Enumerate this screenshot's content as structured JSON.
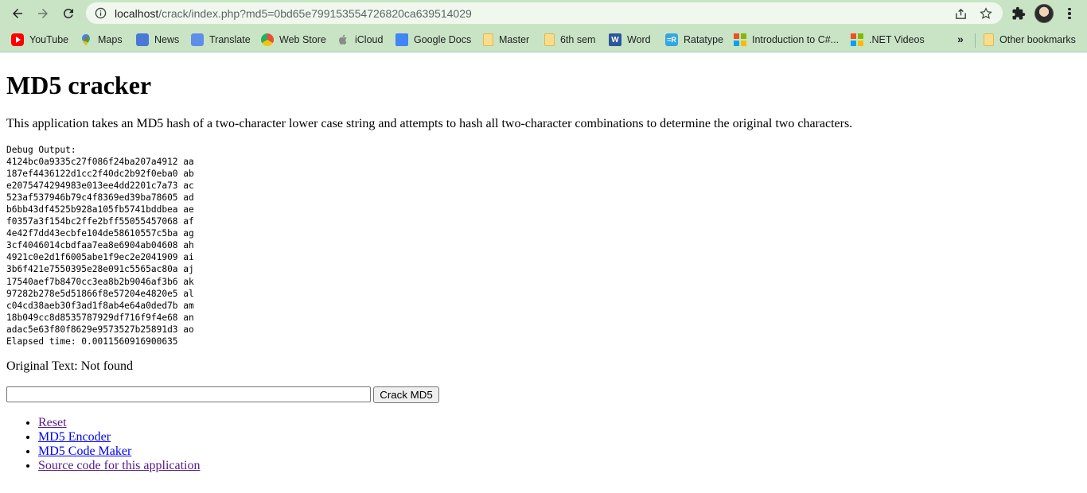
{
  "browser": {
    "url_host": "localhost",
    "url_path": "/crack/index.php?md5=0bd65e799153554726820ca639514029",
    "icons": {
      "back": "arrow-left-icon",
      "forward": "arrow-right-icon",
      "reload": "reload-icon",
      "info": "info-icon",
      "share": "share-icon",
      "bookmark_star": "star-icon",
      "extensions": "puzzle-icon",
      "menu": "kebab-menu-icon"
    },
    "bookmarks": [
      {
        "label": "YouTube",
        "icon": "youtube-icon"
      },
      {
        "label": "Maps",
        "icon": "maps-icon"
      },
      {
        "label": "News",
        "icon": "news-icon"
      },
      {
        "label": "Translate",
        "icon": "translate-icon"
      },
      {
        "label": "Web Store",
        "icon": "webstore-icon"
      },
      {
        "label": "iCloud",
        "icon": "apple-icon"
      },
      {
        "label": "Google Docs",
        "icon": "gdocs-icon"
      },
      {
        "label": "Master",
        "icon": "folder-icon"
      },
      {
        "label": "6th sem",
        "icon": "folder-icon"
      },
      {
        "label": "Word",
        "icon": "word-icon",
        "icon_text": "W"
      },
      {
        "label": "Ratatype",
        "icon": "ratatype-icon",
        "icon_text": "=R"
      },
      {
        "label": "Introduction to C#...",
        "icon": "microsoft-icon"
      },
      {
        "label": ".NET Videos",
        "icon": "microsoft-icon"
      }
    ],
    "more_bookmarks_label": "»",
    "other_bookmarks_label": "Other bookmarks"
  },
  "page": {
    "title": "MD5 cracker",
    "description": "This application takes an MD5 hash of a two-character lower case string and attempts to hash all two-character combinations to determine the original two characters.",
    "debug": {
      "header": "Debug Output:",
      "lines": [
        "4124bc0a9335c27f086f24ba207a4912 aa",
        "187ef4436122d1cc2f40dc2b92f0eba0 ab",
        "e2075474294983e013ee4dd2201c7a73 ac",
        "523af537946b79c4f8369ed39ba78605 ad",
        "b6bb43df4525b928a105fb5741bddbea ae",
        "f0357a3f154bc2ffe2bff55055457068 af",
        "4e42f7dd43ecbfe104de58610557c5ba ag",
        "3cf4046014cbdfaa7ea8e6904ab04608 ah",
        "4921c0e2d1f6005abe1f9ec2e2041909 ai",
        "3b6f421e7550395e28e091c5565ac80a aj",
        "17540aef7b8470cc3ea8b2b9046af3b6 ak",
        "97282b278e5d51866f8e57204e4820e5 al",
        "c04cd38aeb30f3ad1f8ab4e64a0ded7b am",
        "18b049cc8d8535787929df716f9f4e68 an",
        "adac5e63f80f8629e9573527b25891d3 ao"
      ],
      "elapsed": "Elapsed time: 0.0011560916900635"
    },
    "original_label": "Original Text:",
    "original_value": "Not found",
    "input": {
      "value": "",
      "placeholder": ""
    },
    "crack_button_label": "Crack MD5",
    "links": [
      {
        "label": "Reset",
        "visited": true
      },
      {
        "label": "MD5 Encoder",
        "visited": false
      },
      {
        "label": "MD5 Code Maker",
        "visited": false
      },
      {
        "label": "Source code for this application",
        "visited": true
      }
    ]
  }
}
